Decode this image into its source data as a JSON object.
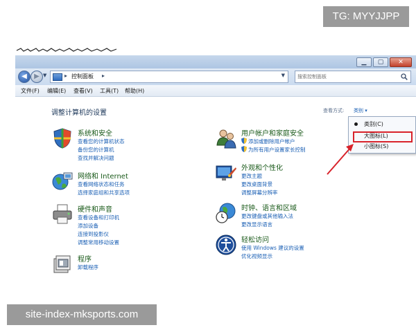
{
  "watermarks": {
    "top": "TG: MYYJJPP",
    "bottom": "site-index-mksports.com"
  },
  "window": {
    "address": {
      "path": "控制面板",
      "search_placeholder": "搜索控制面板"
    },
    "menu": [
      "文件(F)",
      "编辑(E)",
      "查看(V)",
      "工具(T)",
      "帮助(H)"
    ],
    "content": {
      "title": "调整计算机的设置",
      "view_by_label": "查看方式:",
      "view_by_value": "类别 ▾",
      "categories": [
        {
          "title": "系统和安全",
          "links": [
            "查看您的计算机状态",
            "备份您的计算机",
            "查找并解决问题"
          ]
        },
        {
          "title": "网络和 Internet",
          "links": [
            "查看网络状态和任务",
            "选择家庭组和共享选项"
          ]
        },
        {
          "title": "硬件和声音",
          "links": [
            "查看设备和打印机",
            "添加设备",
            "连接到投影仪",
            "调整常用移动设置"
          ]
        },
        {
          "title": "程序",
          "links": [
            "卸载程序"
          ]
        },
        {
          "title": "用户帐户和家庭安全",
          "links": [
            "添加或删除用户帐户",
            "为所有用户设置家长控制"
          ]
        },
        {
          "title": "外观和个性化",
          "links": [
            "更改主题",
            "更改桌面背景",
            "调整屏幕分辨率"
          ]
        },
        {
          "title": "时钟、语言和区域",
          "links": [
            "更改键盘或其他输入法",
            "更改显示语言"
          ]
        },
        {
          "title": "轻松访问",
          "links": [
            "使用 Windows 建议的设置",
            "优化视频显示"
          ]
        }
      ]
    },
    "view_menu": {
      "items": [
        "类别(C)",
        "大图标(L)",
        "小图标(S)"
      ],
      "selected": "类别(C)",
      "highlighted": "大图标(L)"
    }
  },
  "colors": {
    "highlight_border": "#d8222a",
    "arrow": "#d8222a",
    "link": "#1a5fb4",
    "category_title": "#1a5a1a"
  },
  "icons": [
    "back-arrow-icon",
    "forward-arrow-icon",
    "control-panel-icon",
    "refresh-icon",
    "search-icon",
    "minimize-icon",
    "maximize-icon",
    "close-icon",
    "shield-icon"
  ]
}
